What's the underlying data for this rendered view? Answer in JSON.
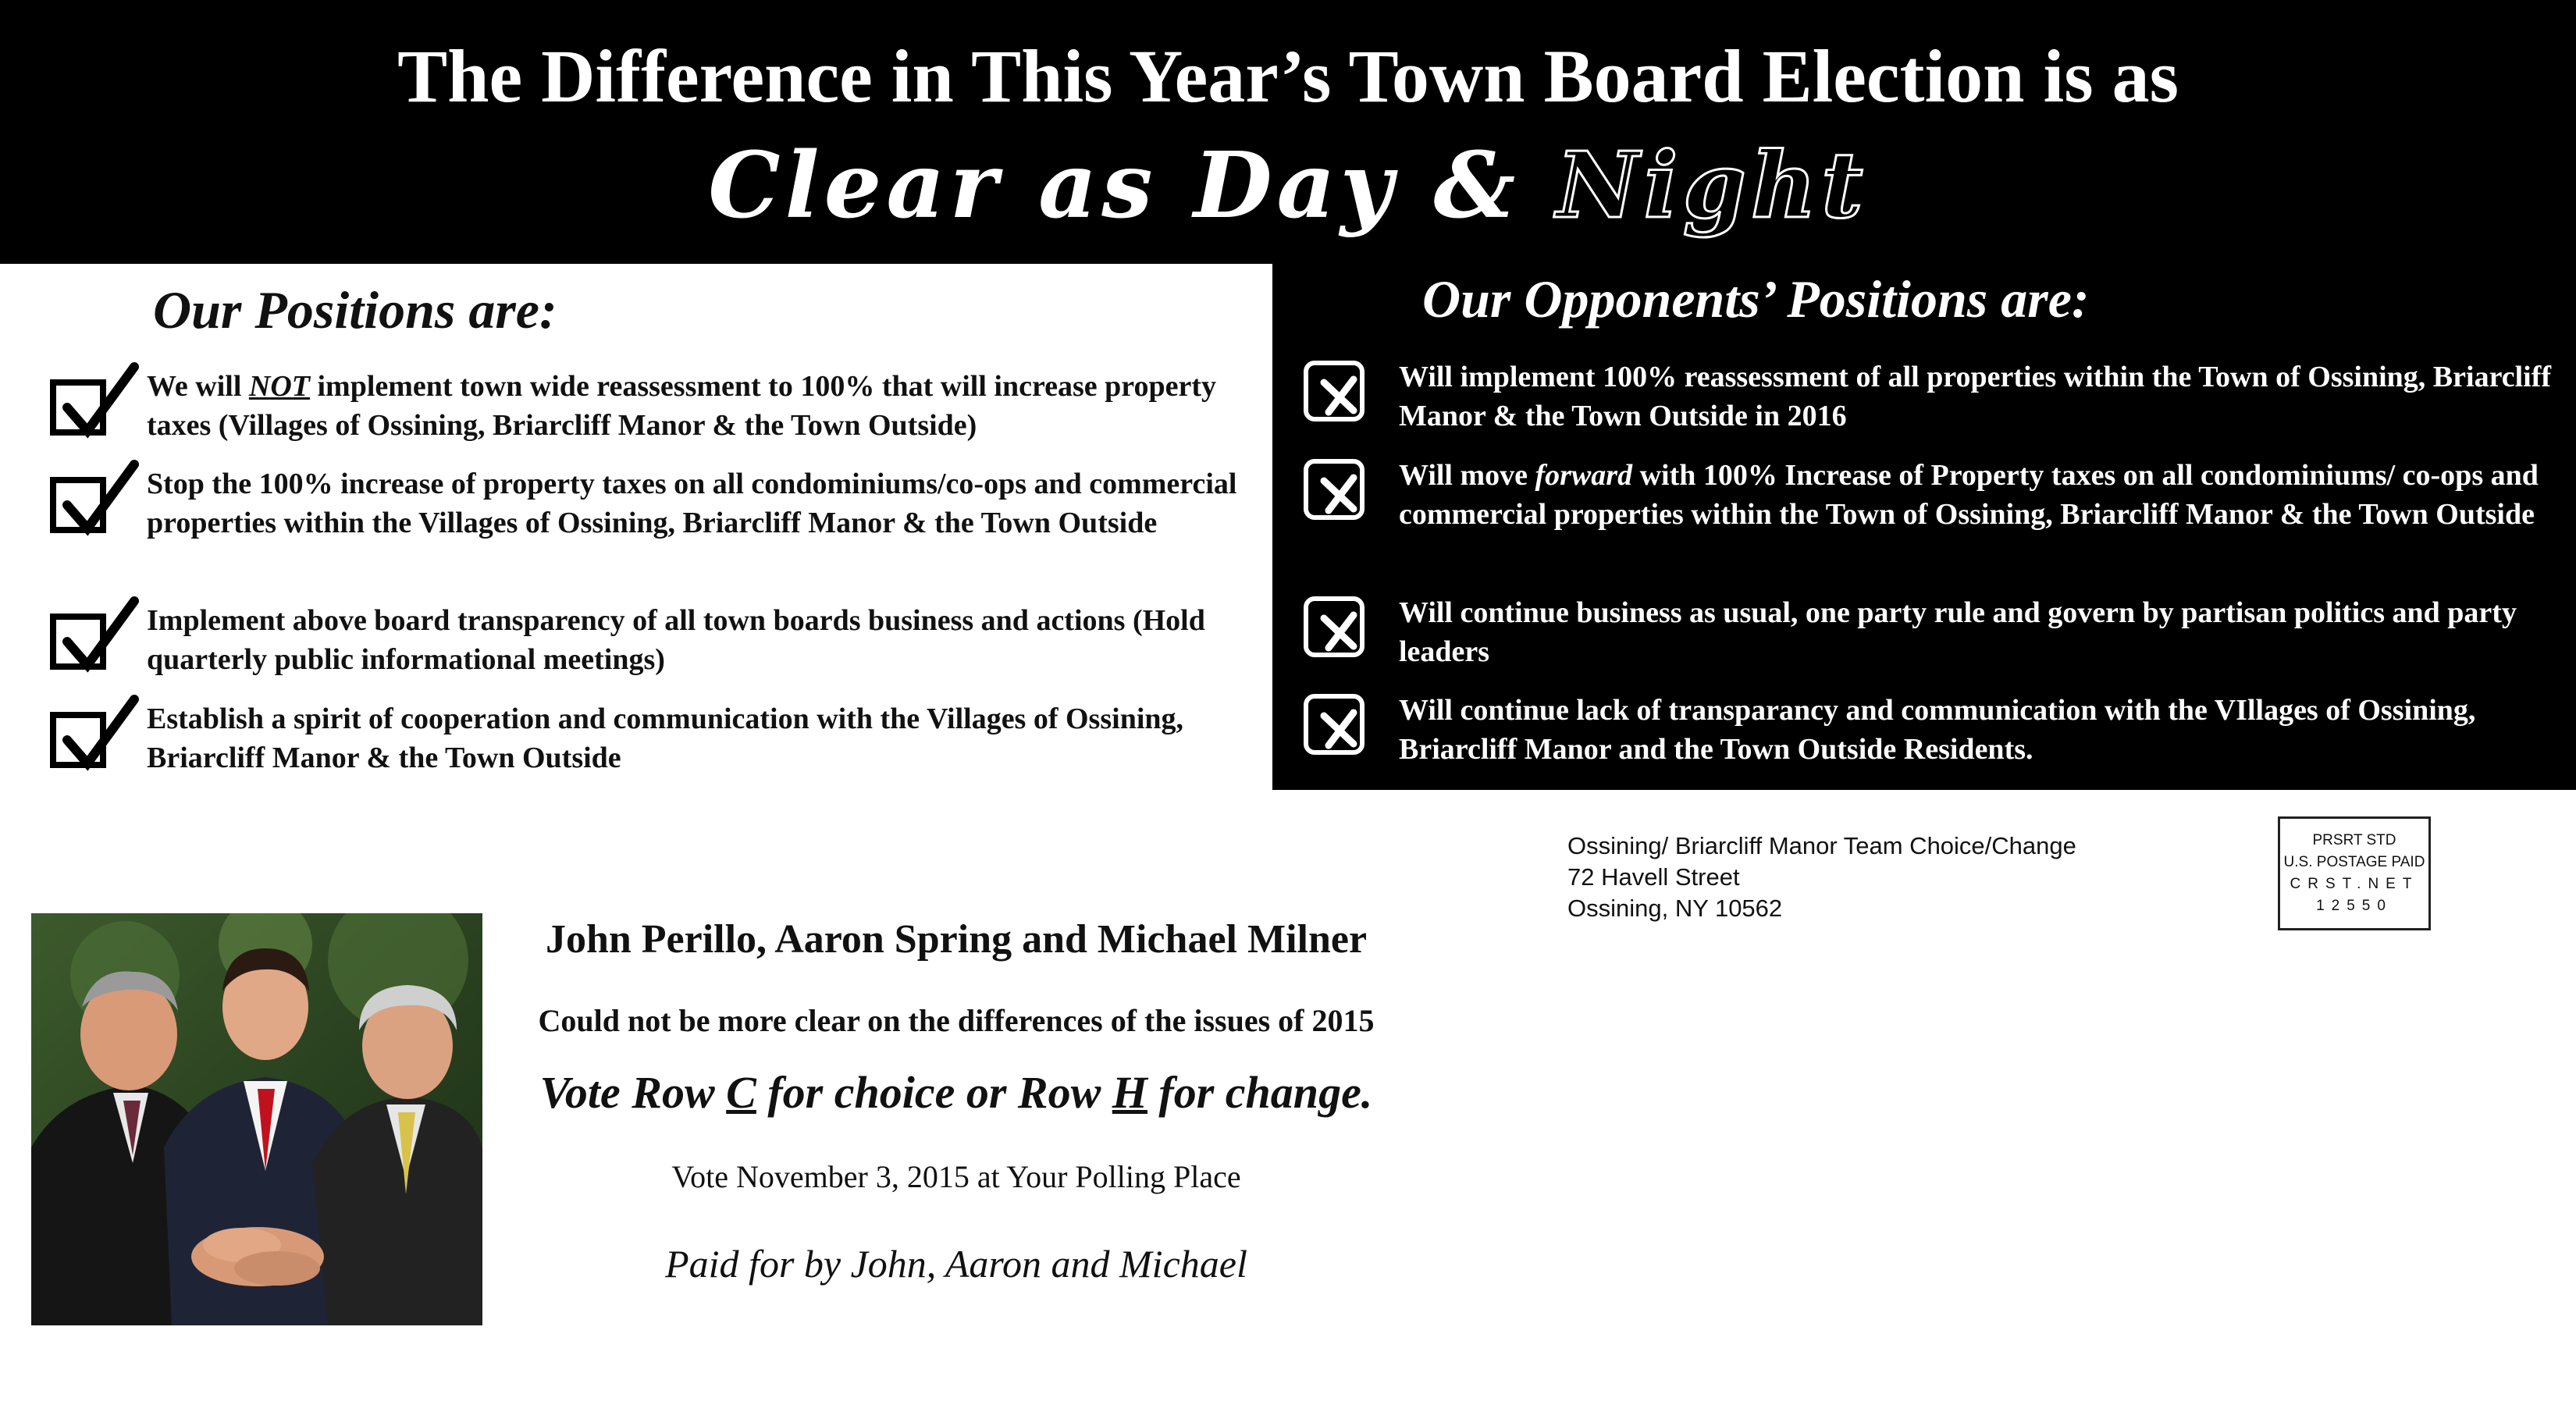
{
  "header": {
    "line1": "The Difference in This Year’s Town Board Election is as",
    "line2_part1": "Clear as Day & ",
    "line2_night": "Night"
  },
  "our_positions": {
    "title": "Our Positions are:",
    "items": [
      {
        "pre": "We will ",
        "emphasis": "NOT",
        "post": " implement town wide reassessment to 100% that will increase property taxes (Villages of Ossining, Briarcliff Manor & the Town Outside)"
      },
      {
        "text": "Stop the 100% increase of property taxes on all condominiums/co-ops and commercial properties within the Villages of Ossining, Briarcliff Manor & the Town Outside"
      },
      {
        "text": "Implement above board transparency of all town boards business and actions (Hold quarterly public informational meetings)"
      },
      {
        "text": "Establish a spirit of cooperation and communication with the Villages of Ossining, Briarcliff Manor & the Town Outside"
      }
    ]
  },
  "opponents_positions": {
    "title": "Our Opponents’ Positions are:",
    "items": [
      {
        "text": "Will implement 100% reassessment of all properties within the Town of Ossining, Briarcliff Manor & the Town Outside in 2016"
      },
      {
        "pre": "Will  move ",
        "emphasis": "forward",
        "post": " with 100% Increase of Property taxes on all condominiums/ co-ops and commercial properties within the Town of Ossining, Briarcliff Manor & the Town Outside"
      },
      {
        "text": "Will continue business as usual, one party rule and govern by partisan politics and party leaders"
      },
      {
        "text": "Will continue lack of transparancy and communication with the VIllages of Ossining, Briarcliff Manor and the Town Outside Residents."
      }
    ]
  },
  "return_address": {
    "line1": "Ossining/ Briarcliff Manor Team Choice/Change",
    "line2": "72 Havell Street",
    "line3": "Ossining, NY 10562"
  },
  "indicia": {
    "line1": "PRSRT STD",
    "line2": "U.S. POSTAGE PAID",
    "line3": "CRST.NET",
    "line4": "12550"
  },
  "footer": {
    "candidates": "John Perillo, Aaron Spring and Michael Milner",
    "clear_line": "Could not be more clear on the differences of the issues of 2015",
    "vote_pre": "Vote Row ",
    "vote_c": "C",
    "vote_mid": " for choice or Row ",
    "vote_h": "H",
    "vote_post": " for change.",
    "vote_date": "Vote November 3, 2015 at Your Polling Place",
    "paid_for": "Paid for by John, Aaron and Michael"
  },
  "colors": {
    "header_bg": "#000000",
    "header_text": "#ffffff",
    "panel_bg": "#000000"
  }
}
